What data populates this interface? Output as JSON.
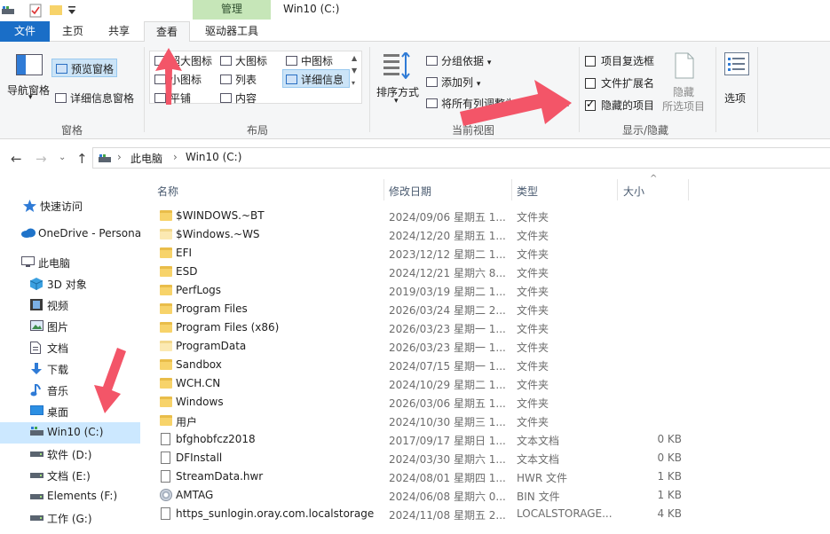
{
  "window": {
    "title": "Win10 (C:)",
    "manage_label": "管理"
  },
  "tabs": {
    "file": "文件",
    "home": "主页",
    "share": "共享",
    "view": "查看",
    "drive_tools": "驱动器工具"
  },
  "ribbon": {
    "pane": {
      "nav_pane": "导航窗格",
      "preview_pane": "预览窗格",
      "details_pane": "详细信息窗格",
      "group_label": "窗格"
    },
    "layout": {
      "extra_large_icons": "超大图标",
      "large_icons": "大图标",
      "medium_icons": "中图标",
      "small_icons": "小图标",
      "list": "列表",
      "details": "详细信息",
      "tiles": "平铺",
      "content": "内容",
      "group_label": "布局"
    },
    "current_view": {
      "sort_by": "排序方式",
      "group_by": "分组依据",
      "add_columns": "添加列",
      "fit_columns": "将所有列调整为合适的大小",
      "group_label": "当前视图"
    },
    "show_hide": {
      "item_checkboxes": "项目复选框",
      "file_extensions": "文件扩展名",
      "hidden_items": "隐藏的项目",
      "hide_selected_1": "隐藏",
      "hide_selected_2": "所选项目",
      "options": "选项",
      "group_label": "显示/隐藏",
      "checks": {
        "item_checkboxes": false,
        "file_extensions": false,
        "hidden_items": true
      }
    }
  },
  "address": {
    "crumbs": [
      "此电脑",
      "Win10 (C:)"
    ]
  },
  "sidebar": {
    "items": [
      {
        "label": "快速访问",
        "icon": "star-icon"
      },
      {
        "label": "OneDrive - Persona",
        "icon": "cloud-icon"
      },
      {
        "label": "此电脑",
        "icon": "computer-icon"
      },
      {
        "label": "3D 对象",
        "icon": "cube-icon"
      },
      {
        "label": "视频",
        "icon": "video-icon"
      },
      {
        "label": "图片",
        "icon": "picture-icon"
      },
      {
        "label": "文档",
        "icon": "document-icon"
      },
      {
        "label": "下载",
        "icon": "download-icon"
      },
      {
        "label": "音乐",
        "icon": "music-icon"
      },
      {
        "label": "桌面",
        "icon": "desktop-icon"
      },
      {
        "label": "Win10 (C:)",
        "icon": "system-drive-icon"
      },
      {
        "label": "软件 (D:)",
        "icon": "drive-icon"
      },
      {
        "label": "文档 (E:)",
        "icon": "drive-icon"
      },
      {
        "label": "Elements (F:)",
        "icon": "drive-icon"
      },
      {
        "label": "工作 (G:)",
        "icon": "drive-icon"
      }
    ]
  },
  "columns": {
    "name": "名称",
    "date": "修改日期",
    "type": "类型",
    "size": "大小"
  },
  "files": [
    {
      "name": "$WINDOWS.~BT",
      "date": "2024/09/06  星期五 1...",
      "type": "文件夹",
      "size": "",
      "kind": "folder"
    },
    {
      "name": "$Windows.~WS",
      "date": "2024/12/20  星期五 1...",
      "type": "文件夹",
      "size": "",
      "kind": "folder-pale"
    },
    {
      "name": "EFI",
      "date": "2023/12/12  星期二 1...",
      "type": "文件夹",
      "size": "",
      "kind": "folder"
    },
    {
      "name": "ESD",
      "date": "2024/12/21  星期六 8...",
      "type": "文件夹",
      "size": "",
      "kind": "folder"
    },
    {
      "name": "PerfLogs",
      "date": "2019/03/19  星期二 1...",
      "type": "文件夹",
      "size": "",
      "kind": "folder"
    },
    {
      "name": "Program Files",
      "date": "2026/03/24  星期二 2...",
      "type": "文件夹",
      "size": "",
      "kind": "folder"
    },
    {
      "name": "Program Files (x86)",
      "date": "2026/03/23  星期一 1...",
      "type": "文件夹",
      "size": "",
      "kind": "folder"
    },
    {
      "name": "ProgramData",
      "date": "2026/03/23  星期一 1...",
      "type": "文件夹",
      "size": "",
      "kind": "folder-pale"
    },
    {
      "name": "Sandbox",
      "date": "2024/07/15  星期一 1...",
      "type": "文件夹",
      "size": "",
      "kind": "folder"
    },
    {
      "name": "WCH.CN",
      "date": "2024/10/29  星期二 1...",
      "type": "文件夹",
      "size": "",
      "kind": "folder"
    },
    {
      "name": "Windows",
      "date": "2026/03/06  星期五 1...",
      "type": "文件夹",
      "size": "",
      "kind": "folder"
    },
    {
      "name": "用户",
      "date": "2024/10/30  星期三 1...",
      "type": "文件夹",
      "size": "",
      "kind": "folder"
    },
    {
      "name": "bfghobfcz2018",
      "date": "2017/09/17  星期日 1...",
      "type": "文本文档",
      "size": "0 KB",
      "kind": "doc"
    },
    {
      "name": "DFInstall",
      "date": "2024/03/30  星期六 1...",
      "type": "文本文档",
      "size": "0 KB",
      "kind": "doc"
    },
    {
      "name": "StreamData.hwr",
      "date": "2024/08/01  星期四 1...",
      "type": "HWR 文件",
      "size": "1 KB",
      "kind": "doc"
    },
    {
      "name": "AMTAG",
      "date": "2024/06/08  星期六 0...",
      "type": "BIN 文件",
      "size": "1 KB",
      "kind": "disc"
    },
    {
      "name": "https_sunlogin.oray.com.localstorage",
      "date": "2024/11/08  星期五 2...",
      "type": "LOCALSTORAGE...",
      "size": "4 KB",
      "kind": "doc"
    }
  ]
}
